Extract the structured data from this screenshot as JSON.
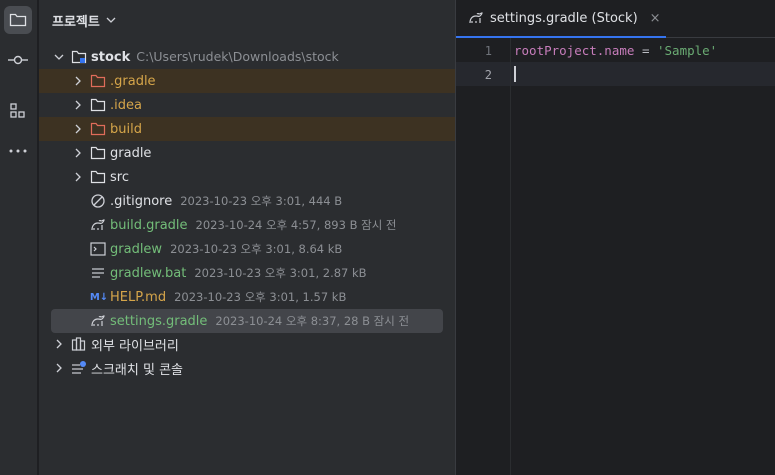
{
  "project_panel": {
    "title": "프로젝트",
    "root": {
      "name": "stock",
      "path": "C:\\Users\\rudek\\Downloads\\stock"
    },
    "folders": [
      {
        "label": ".gradle",
        "status": "ignored"
      },
      {
        "label": ".idea",
        "status": "ignored"
      },
      {
        "label": "build",
        "status": "ignored"
      },
      {
        "label": "gradle",
        "status": "normal"
      },
      {
        "label": "src",
        "status": "normal"
      }
    ],
    "files": [
      {
        "label": ".gitignore",
        "meta": "2023-10-23 오후 3:01, 444 B",
        "status": "normal"
      },
      {
        "label": "build.gradle",
        "meta": "2023-10-24 오후 4:57, 893 B 잠시 전",
        "status": "new"
      },
      {
        "label": "gradlew",
        "meta": "2023-10-23 오후 3:01, 8.64 kB",
        "status": "new"
      },
      {
        "label": "gradlew.bat",
        "meta": "2023-10-23 오후 3:01, 2.87 kB",
        "status": "new"
      },
      {
        "label": "HELP.md",
        "meta": "2023-10-23 오후 3:01, 1.57 kB",
        "status": "ignored"
      },
      {
        "label": "settings.gradle",
        "meta": "2023-10-24 오후 8:37, 28 B 잠시 전",
        "status": "new"
      }
    ],
    "external_libraries": "외부 라이브러리",
    "scratches": "스크래치 및 콘솔",
    "md_badge": "M↓"
  },
  "editor": {
    "tab_label": "settings.gradle (Stock)",
    "tab_close": "×",
    "line_numbers": [
      "1",
      "2"
    ],
    "code_line1": {
      "prop": "rootProject.name",
      "op": " = ",
      "str": "'Sample'"
    }
  },
  "colors": {
    "accent": "#3574f0",
    "ignored_text": "#d5a54a",
    "new_file_text": "#73bd79",
    "ignored_row_bg": "#3d3222"
  }
}
